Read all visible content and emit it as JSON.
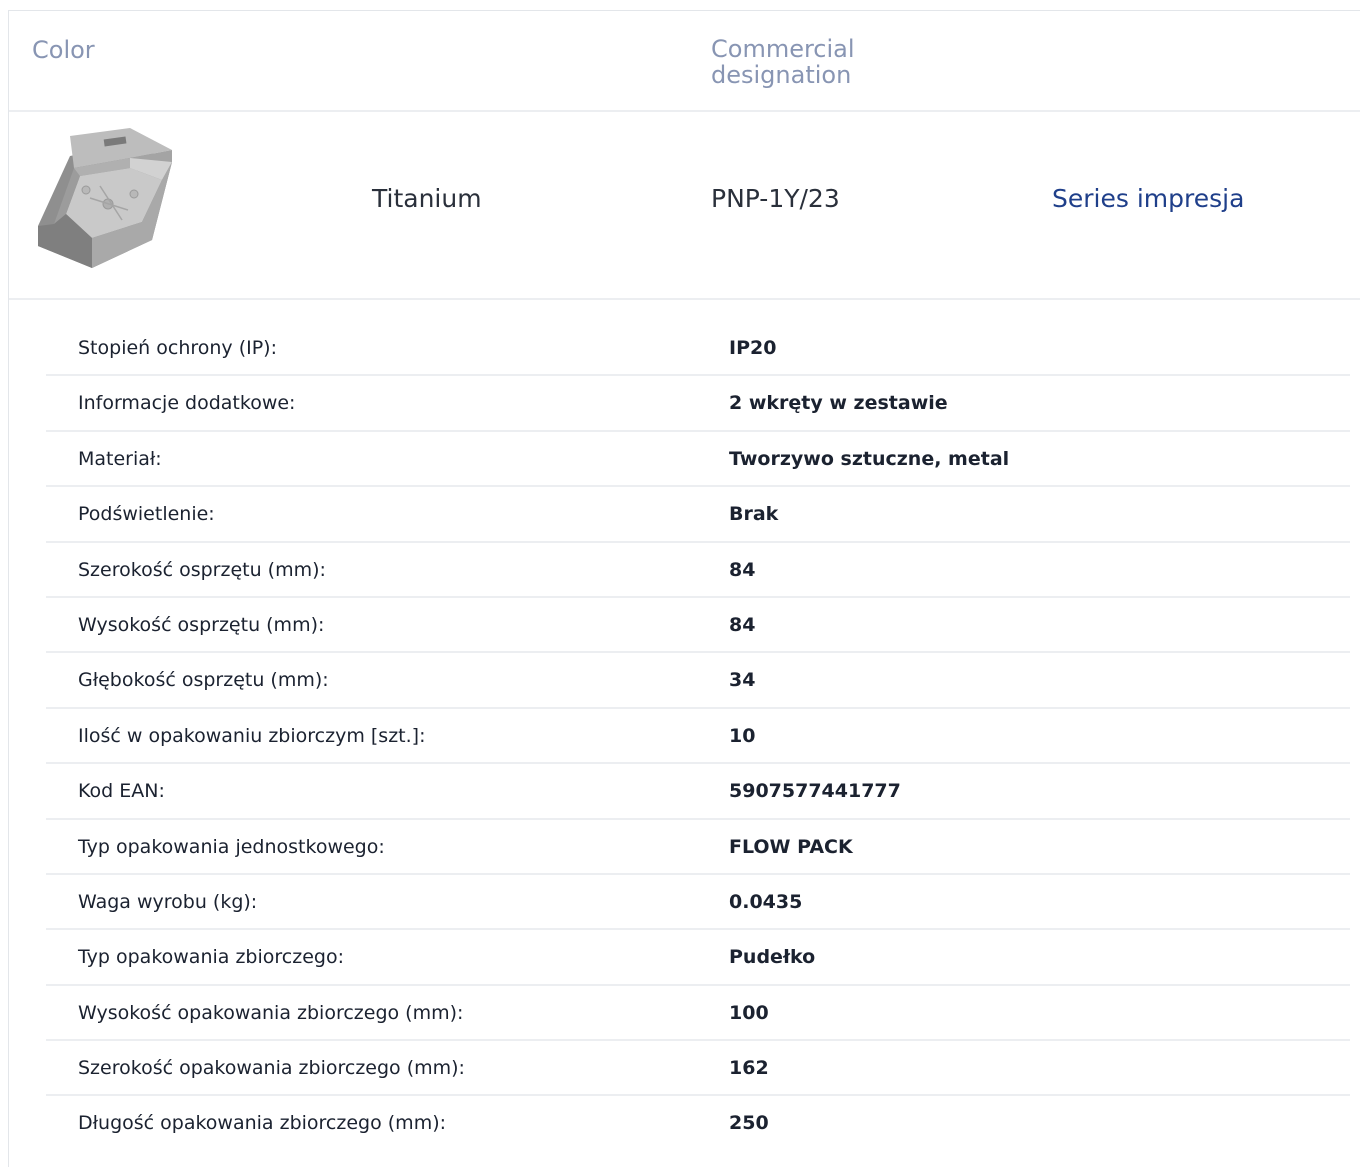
{
  "header": {
    "color_label": "Color",
    "commercial_label": "Commercial designation"
  },
  "product": {
    "image_icon": "product-box-photo",
    "color": "Titanium",
    "designation": "PNP-1Y/23",
    "series_link": "Series impresja"
  },
  "specs": [
    {
      "label": "Stopień ochrony (IP):",
      "value": "IP20"
    },
    {
      "label": "Informacje dodatkowe:",
      "value": "2 wkręty w zestawie"
    },
    {
      "label": "Materiał:",
      "value": "Tworzywo sztuczne, metal"
    },
    {
      "label": "Podświetlenie:",
      "value": "Brak"
    },
    {
      "label": "Szerokość osprzętu (mm):",
      "value": "84"
    },
    {
      "label": "Wysokość osprzętu (mm):",
      "value": "84"
    },
    {
      "label": "Głębokość osprzętu (mm):",
      "value": "34"
    },
    {
      "label": "Ilość w opakowaniu zbiorczym [szt.]:",
      "value": "10"
    },
    {
      "label": "Kod EAN:",
      "value": "5907577441777"
    },
    {
      "label": "Typ opakowania jednostkowego:",
      "value": "FLOW PACK"
    },
    {
      "label": "Waga wyrobu (kg):",
      "value": "0.0435"
    },
    {
      "label": "Typ opakowania zbiorczego:",
      "value": "Pudełko"
    },
    {
      "label": "Wysokość opakowania zbiorczego (mm):",
      "value": "100"
    },
    {
      "label": "Szerokość opakowania zbiorczego (mm):",
      "value": "162"
    },
    {
      "label": "Długość opakowania zbiorczego (mm):",
      "value": "250"
    }
  ],
  "colors": {
    "header_text": "#8895b3",
    "link": "#1f3f8a",
    "divider": "#eceef1"
  }
}
